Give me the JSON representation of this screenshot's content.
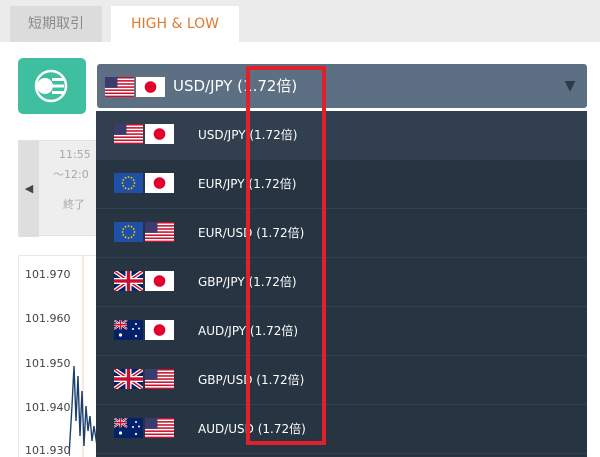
{
  "tabs": [
    {
      "label": "短期取引",
      "active": false
    },
    {
      "label": "HIGH & LOW",
      "active": true
    }
  ],
  "selected": {
    "label": "USD/JPY (1.72倍)",
    "base_flag": "us-flag",
    "quote_flag": "jp-flag"
  },
  "time_panel": {
    "start": "11:55",
    "end": "～12:0",
    "status": "終了"
  },
  "chart": {
    "y_ticks": [
      "101.970",
      "101.960",
      "101.950",
      "101.940",
      "101.930"
    ]
  },
  "pairs": [
    {
      "label": "USD/JPY (1.72倍)",
      "base": "us",
      "quote": "jp"
    },
    {
      "label": "EUR/JPY (1.72倍)",
      "base": "eu",
      "quote": "jp"
    },
    {
      "label": "EUR/USD (1.72倍)",
      "base": "eu",
      "quote": "us"
    },
    {
      "label": "GBP/JPY (1.72倍)",
      "base": "gb",
      "quote": "jp"
    },
    {
      "label": "AUD/JPY (1.72倍)",
      "base": "au",
      "quote": "jp"
    },
    {
      "label": "GBP/USD (1.72倍)",
      "base": "gb",
      "quote": "us"
    },
    {
      "label": "AUD/USD (1.72倍)",
      "base": "au",
      "quote": "us"
    }
  ],
  "colors": {
    "accent_tab": "#e07a2c",
    "icon_bg": "#3fbfa0",
    "dropdown_bg": "#273442",
    "highlight": "#e0202a"
  }
}
